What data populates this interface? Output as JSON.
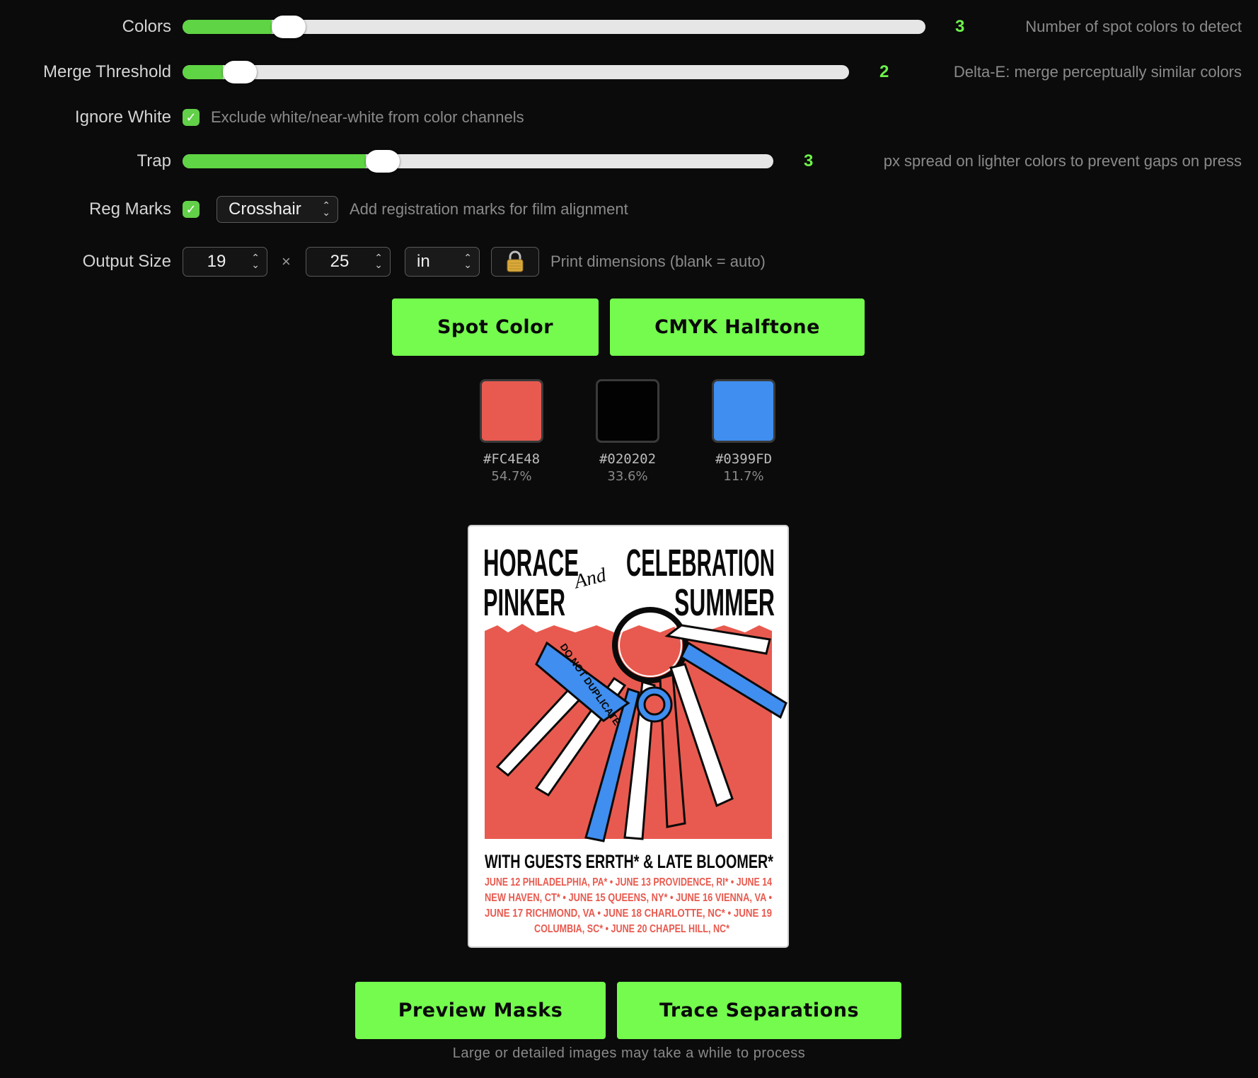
{
  "controls": {
    "colors": {
      "label": "Colors",
      "value": "3",
      "fraction": 0.12,
      "desc": "Number of spot colors to detect"
    },
    "merge": {
      "label": "Merge Threshold",
      "value": "2",
      "fraction": 0.06,
      "desc": "Delta-E: merge perceptually similar colors"
    },
    "ignore_white": {
      "label": "Ignore White",
      "checked": true,
      "desc": "Exclude white/near-white from color channels"
    },
    "trap": {
      "label": "Trap",
      "value": "3",
      "fraction": 0.31,
      "desc": "px spread on lighter colors to prevent gaps on press"
    },
    "reg_marks": {
      "label": "Reg Marks",
      "checked": true,
      "selected": "Crosshair",
      "desc": "Add registration marks for film alignment"
    },
    "output_size": {
      "label": "Output Size",
      "width": "19",
      "times": "×",
      "height": "25",
      "unit": "in",
      "desc": "Print dimensions (blank = auto)"
    }
  },
  "mode_buttons": {
    "spot": "Spot Color",
    "cmyk": "CMYK Halftone"
  },
  "swatches": [
    {
      "hex": "#FC4E48",
      "pct": "54.7%",
      "color": "#e85a4f"
    },
    {
      "hex": "#020202",
      "pct": "33.6%",
      "color": "#020202"
    },
    {
      "hex": "#0399FD",
      "pct": "11.7%",
      "color": "#3f8ef0"
    }
  ],
  "poster": {
    "line1_left": "HORACE",
    "line1_right": "CELEBRATION",
    "line2_left": "PINKER",
    "line2_right": "SUMMER",
    "and": "And",
    "tag": "DO NOT DUPLICATE",
    "guests": "WITH GUESTS ERRTH* & LATE BLOOMER*",
    "dates": [
      "JUNE 12 PHILADELPHIA, PA* • JUNE 13 PROVIDENCE, RI* • JUNE 14",
      "NEW HAVEN, CT* • JUNE 15 QUEENS, NY* • JUNE 16 VIENNA, VA •",
      "JUNE 17 RICHMOND, VA • JUNE 18 CHARLOTTE, NC* • JUNE 19",
      "COLUMBIA, SC* • JUNE 20 CHAPEL HILL, NC*"
    ],
    "colors": {
      "red": "#e85a4f",
      "blue": "#3f8ef0",
      "black": "#0a0a0a"
    }
  },
  "action_buttons": {
    "preview": "Preview Masks",
    "trace": "Trace Separations"
  },
  "footer": "Large or detailed images may take a while to process",
  "accent": "#74fb4e"
}
